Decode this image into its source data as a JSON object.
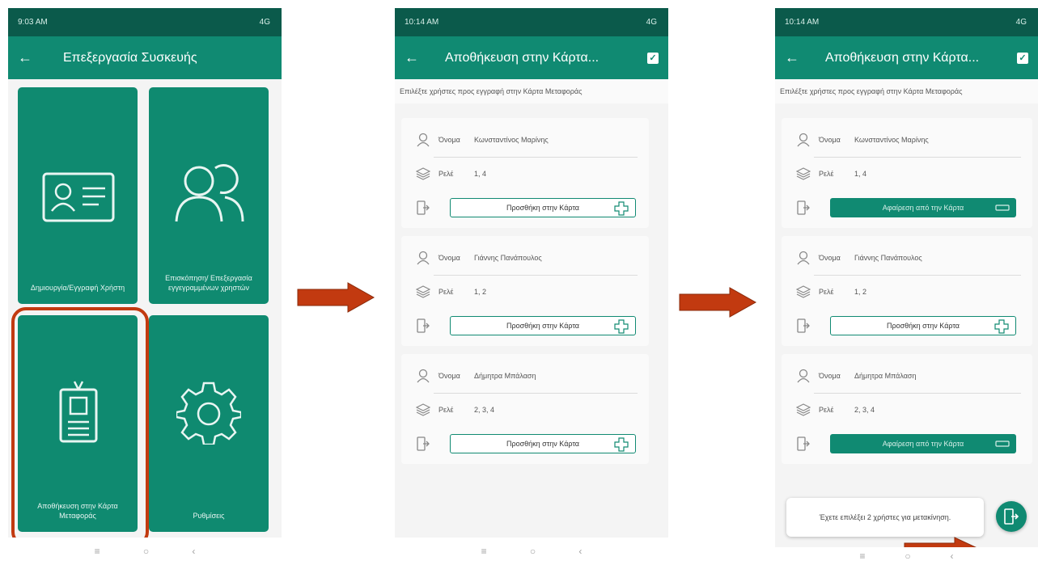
{
  "phone1": {
    "status_time": "9:03 AM",
    "status_right": "4G",
    "title": "Επεξεργασία Συσκευής",
    "tiles": [
      {
        "label": "Δημιουργία/Εγγραφή Χρήστη",
        "icon": "id-card-icon"
      },
      {
        "label": "Επισκόπηση/ Επεξεργασία εγγεγραμμένων χρηστών",
        "icon": "users-icon"
      },
      {
        "label": "Αποθήκευση στην Κάρτα Μεταφοράς",
        "icon": "badge-icon"
      },
      {
        "label": "Ρυθμίσεις",
        "icon": "gear-icon"
      }
    ]
  },
  "phone2": {
    "status_time": "10:14 AM",
    "status_right": "4G",
    "title": "Αποθήκευση στην Κάρτα...",
    "subtitle": "Επιλέξτε χρήστες προς εγγραφή στην Κάρτα Μεταφοράς",
    "name_key": "Όνομα",
    "roles_key": "Ρελέ",
    "users": [
      {
        "name": "Κωνσταντίνος Μαρίνης",
        "roles": "1, 4",
        "action": "Προσθήκη στην Κάρτα"
      },
      {
        "name": "Γιάννης Πανάπουλος",
        "roles": "1, 2",
        "action": "Προσθήκη στην Κάρτα"
      },
      {
        "name": "Δήμητρα Μπάλαση",
        "roles": "2, 3, 4",
        "action": "Προσθήκη στην Κάρτα"
      }
    ]
  },
  "phone3": {
    "status_time": "10:14 AM",
    "status_right": "4G",
    "title": "Αποθήκευση στην Κάρτα...",
    "subtitle": "Επιλέξτε χρήστες προς εγγραφή στην Κάρτα Μεταφοράς",
    "name_key": "Όνομα",
    "roles_key": "Ρελέ",
    "users": [
      {
        "name": "Κωνσταντίνος Μαρίνης",
        "roles": "1, 4",
        "action": "Αφαίρεση από την Κάρτα"
      },
      {
        "name": "Γιάννης Πανάπουλος",
        "roles": "1, 2",
        "action": "Προσθήκη στην Κάρτα"
      },
      {
        "name": "Δήμητρα Μπάλαση",
        "roles": "2, 3, 4",
        "action": "Αφαίρεση από την Κάρτα"
      }
    ],
    "toast": "Έχετε επιλέξει 2 χρήστες για μετακίνηση."
  },
  "colors": {
    "primary": "#108a72",
    "statusbar": "#0b5a4b",
    "arrow": "#c23a10"
  }
}
